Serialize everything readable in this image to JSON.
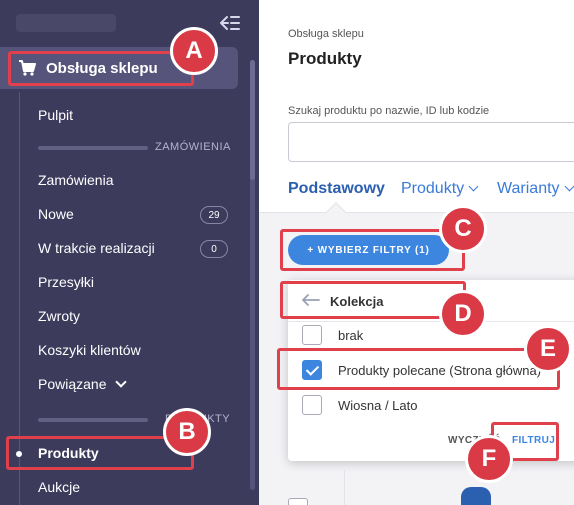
{
  "sidebar": {
    "shop_label": "Obsługa sklepu",
    "items": [
      {
        "label": "Pulpit"
      },
      {
        "label": "Zamówienia"
      },
      {
        "label": "Nowe",
        "badge": "29"
      },
      {
        "label": "W trakcie realizacji",
        "badge": "0"
      },
      {
        "label": "Przesyłki"
      },
      {
        "label": "Zwroty"
      },
      {
        "label": "Koszyki klientów"
      },
      {
        "label": "Powiązane"
      },
      {
        "label": "Produkty"
      },
      {
        "label": "Aukcje"
      }
    ],
    "section_orders": "ZAMÓWIENIA",
    "section_products": "PRODUKTY"
  },
  "main": {
    "breadcrumb": "Obsługa sklepu",
    "title": "Produkty",
    "search_label": "Szukaj produktu po nazwie, ID lub kodzie",
    "search_value": "",
    "tabs": [
      {
        "label": "Podstawowy"
      },
      {
        "label": "Produkty"
      },
      {
        "label": "Warianty"
      }
    ],
    "filter_button": "+ WYBIERZ FILTRY (1)",
    "popup": {
      "title": "Kolekcja",
      "options": [
        {
          "label": "brak",
          "checked": false
        },
        {
          "label": "Produkty polecane (Strona główna)",
          "checked": true
        },
        {
          "label": "Wiosna / Lato",
          "checked": false
        }
      ],
      "clear_label": "WYCZYŚĆ",
      "filter_label": "FILTRUJ"
    }
  },
  "annotations": [
    "A",
    "B",
    "C",
    "D",
    "E",
    "F"
  ],
  "colors": {
    "sidebar_bg": "#3d3b5c",
    "accent": "#3d86e0",
    "annotation": "#e0404b"
  },
  "icons": [
    "cart-icon",
    "collapse-sidebar-icon",
    "arrow-left-icon",
    "chevron-down-icon",
    "checkmark-icon"
  ]
}
